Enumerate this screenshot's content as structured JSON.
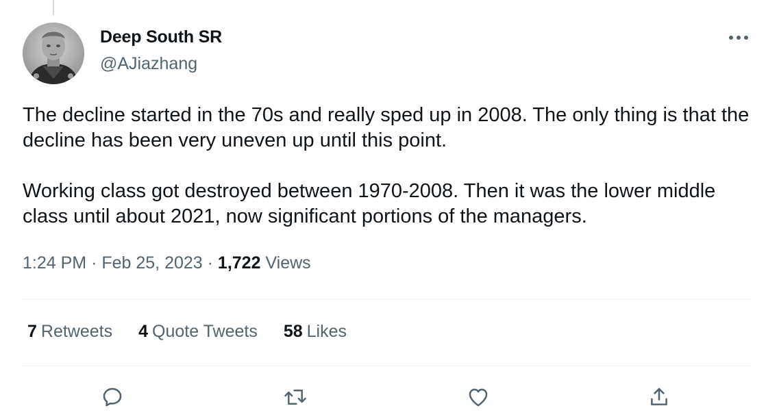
{
  "author": {
    "display_name": "Deep South SR",
    "handle": "@AJiazhang"
  },
  "tweet": {
    "paragraphs": [
      "The decline started in the 70s and really sped up in 2008. The only thing is that the decline has been very uneven up until this point.",
      "Working class got destroyed between 1970-2008. Then it was the lower middle class until about 2021, now significant portions of the managers."
    ],
    "time": "1:24 PM",
    "date": "Feb 25, 2023",
    "separator": "·",
    "views_count": "1,722",
    "views_label": "Views"
  },
  "stats": {
    "retweets": {
      "count": "7",
      "label": "Retweets"
    },
    "quote_tweets": {
      "count": "4",
      "label": "Quote Tweets"
    },
    "likes": {
      "count": "58",
      "label": "Likes"
    }
  },
  "icons": {
    "more": "more-icon",
    "reply": "reply-icon",
    "retweet": "retweet-icon",
    "like": "like-icon",
    "share": "share-icon"
  },
  "colors": {
    "primary_text": "#0f1419",
    "secondary_text": "#536471",
    "divider": "#eff3f4",
    "thread_line": "#cfd9de"
  }
}
